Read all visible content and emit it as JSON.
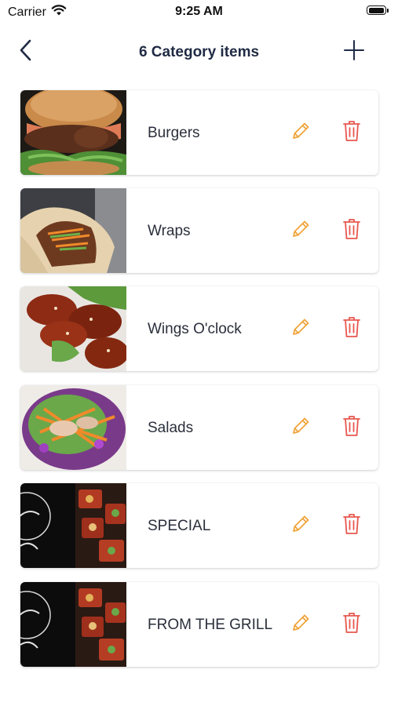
{
  "status_bar": {
    "carrier": "Carrier",
    "time": "9:25 AM"
  },
  "nav": {
    "title": "6 Category items",
    "back_icon": "chevron-left-icon",
    "add_icon": "plus-icon"
  },
  "colors": {
    "edit_icon": "#f0a43a",
    "delete_icon": "#e8574f",
    "title_text": "#1f2a44"
  },
  "categories": [
    {
      "label": "Burgers",
      "image": "burger-photo"
    },
    {
      "label": "Wraps",
      "image": "wrap-photo"
    },
    {
      "label": "Wings O'clock",
      "image": "wings-photo"
    },
    {
      "label": "Salads",
      "image": "salad-photo"
    },
    {
      "label": "SPECIAL",
      "image": "special-photo"
    },
    {
      "label": "FROM THE GRILL",
      "image": "grill-photo"
    }
  ]
}
